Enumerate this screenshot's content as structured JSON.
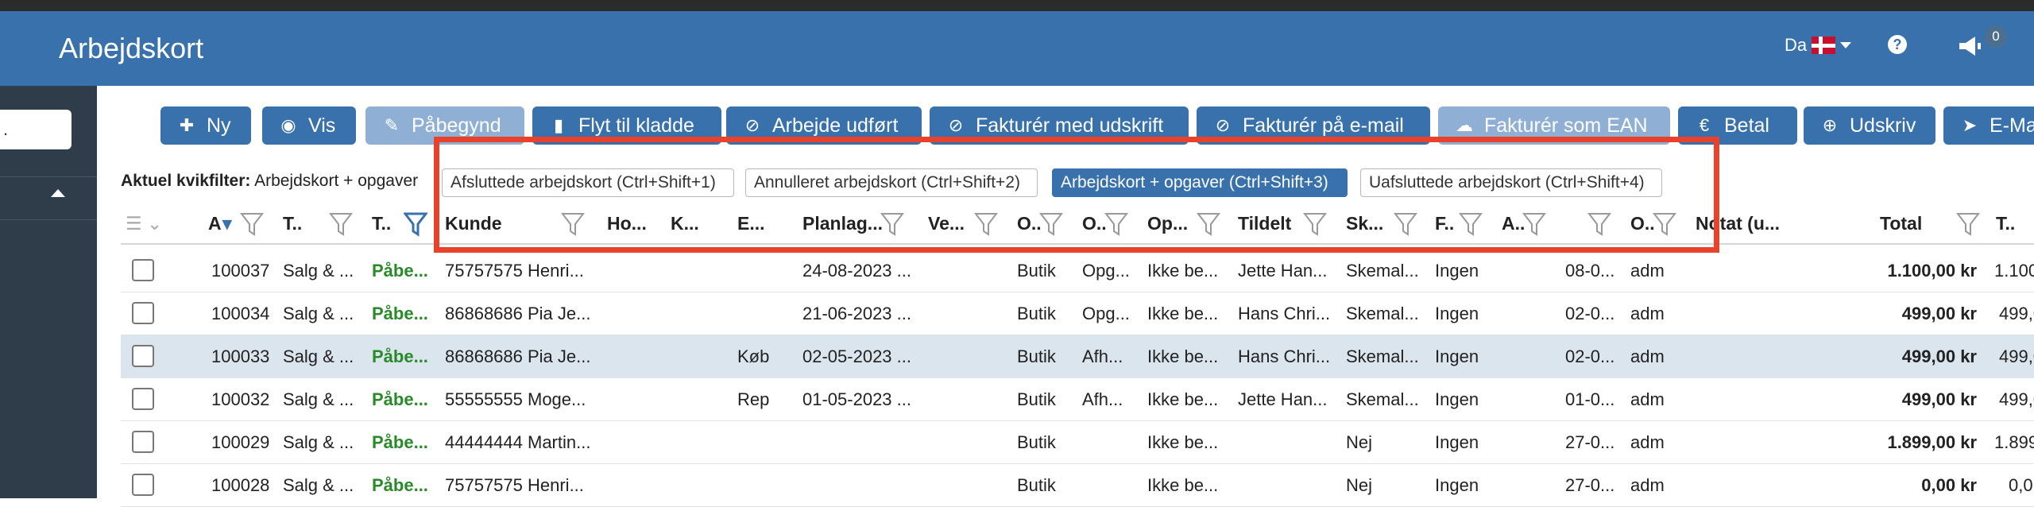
{
  "header": {
    "title": "Arbejdskort",
    "language": "Da",
    "notification_count": "0"
  },
  "sidebar": {
    "search_value": "."
  },
  "toolbar": {
    "new": "Ny",
    "view": "Vis",
    "started": "Påbegynd",
    "move_to_draft": "Flyt til kladde",
    "work_done": "Arbejde udført",
    "invoice_print": "Fakturér med udskrift",
    "invoice_email": "Fakturér på e-mail",
    "invoice_ean": "Fakturér som EAN",
    "pay": "Betal",
    "print": "Udskriv",
    "email": "E-Ma"
  },
  "quickfilter": {
    "label": "Aktuel kvikfilter:",
    "value": "Arbejdskort + opgaver"
  },
  "filters": [
    {
      "label": "Afsluttede arbejdskort (Ctrl+Shift+1)",
      "active": false
    },
    {
      "label": "Annulleret arbejdskort (Ctrl+Shift+2)",
      "active": false
    },
    {
      "label": "Arbejdskort + opgaver (Ctrl+Shift+3)",
      "active": true
    },
    {
      "label": "Uafsluttede arbejdskort (Ctrl+Shift+4)",
      "active": false
    }
  ],
  "columns": {
    "a": "A",
    "t1": "T..",
    "t2": "T..",
    "kunde": "Kunde",
    "ho": "Ho...",
    "k": "K...",
    "e": "E...",
    "planlag": "Planlag...",
    "ve": "Ve...",
    "o1": "O..",
    "o2": "O..",
    "op": "Op...",
    "tildelt": "Tildelt",
    "sk": "Sk...",
    "f": "F..",
    "a2": "A..",
    "o3": "O..",
    "notat": "Notat (u...",
    "total": "Total",
    "t3": "T.."
  },
  "rows": [
    {
      "id": "100037",
      "type": "Salg & ...",
      "status": "Påbe...",
      "kunde": "75757575 Henri...",
      "e": "",
      "planlag": "24-08-2023 ...",
      "o1": "Butik",
      "o2": "Opg...",
      "op": "Ikke be...",
      "tildelt": "Jette Han...",
      "sk": "Skemal...",
      "f": "Ingen",
      "a2": "08-0...",
      "o3": "adm",
      "total": "1.100,00 kr",
      "t3": "1.100,",
      "selected": false
    },
    {
      "id": "100034",
      "type": "Salg & ...",
      "status": "Påbe...",
      "kunde": "86868686 Pia Je...",
      "e": "",
      "planlag": "21-06-2023 ...",
      "o1": "Butik",
      "o2": "Opg...",
      "op": "Ikke be...",
      "tildelt": "Hans Chri...",
      "sk": "Skemal...",
      "f": "Ingen",
      "a2": "02-0...",
      "o3": "adm",
      "total": "499,00 kr",
      "t3": "499,0",
      "selected": false
    },
    {
      "id": "100033",
      "type": "Salg & ...",
      "status": "Påbe...",
      "kunde": "86868686 Pia Je...",
      "e": "Køb",
      "planlag": "02-05-2023 ...",
      "o1": "Butik",
      "o2": "Afh...",
      "op": "Ikke be...",
      "tildelt": "Hans Chri...",
      "sk": "Skemal...",
      "f": "Ingen",
      "a2": "02-0...",
      "o3": "adm",
      "total": "499,00 kr",
      "t3": "499,0",
      "selected": true
    },
    {
      "id": "100032",
      "type": "Salg & ...",
      "status": "Påbe...",
      "kunde": "55555555 Moge...",
      "e": "Rep",
      "planlag": "01-05-2023 ...",
      "o1": "Butik",
      "o2": "Afh...",
      "op": "Ikke be...",
      "tildelt": "Jette Han...",
      "sk": "Skemal...",
      "f": "Ingen",
      "a2": "01-0...",
      "o3": "adm",
      "total": "499,00 kr",
      "t3": "499,0",
      "selected": false
    },
    {
      "id": "100029",
      "type": "Salg & ...",
      "status": "Påbe...",
      "kunde": "44444444 Martin...",
      "e": "",
      "planlag": "",
      "o1": "Butik",
      "o2": "",
      "op": "Ikke be...",
      "tildelt": "",
      "sk": "Nej",
      "f": "Ingen",
      "a2": "27-0...",
      "o3": "adm",
      "total": "1.899,00 kr",
      "t3": "1.899,",
      "selected": false
    },
    {
      "id": "100028",
      "type": "Salg & ...",
      "status": "Påbe...",
      "kunde": "75757575 Henri...",
      "e": "",
      "planlag": "",
      "o1": "Butik",
      "o2": "",
      "op": "Ikke be...",
      "tildelt": "",
      "sk": "Nej",
      "f": "Ingen",
      "a2": "27-0...",
      "o3": "adm",
      "total": "0,00 kr",
      "t3": "0,0",
      "selected": false
    }
  ],
  "colors": {
    "header": "#3871ac",
    "sidebar": "#2f3d4b",
    "highlight": "#e8412c",
    "status_green": "#2a8a2a"
  }
}
